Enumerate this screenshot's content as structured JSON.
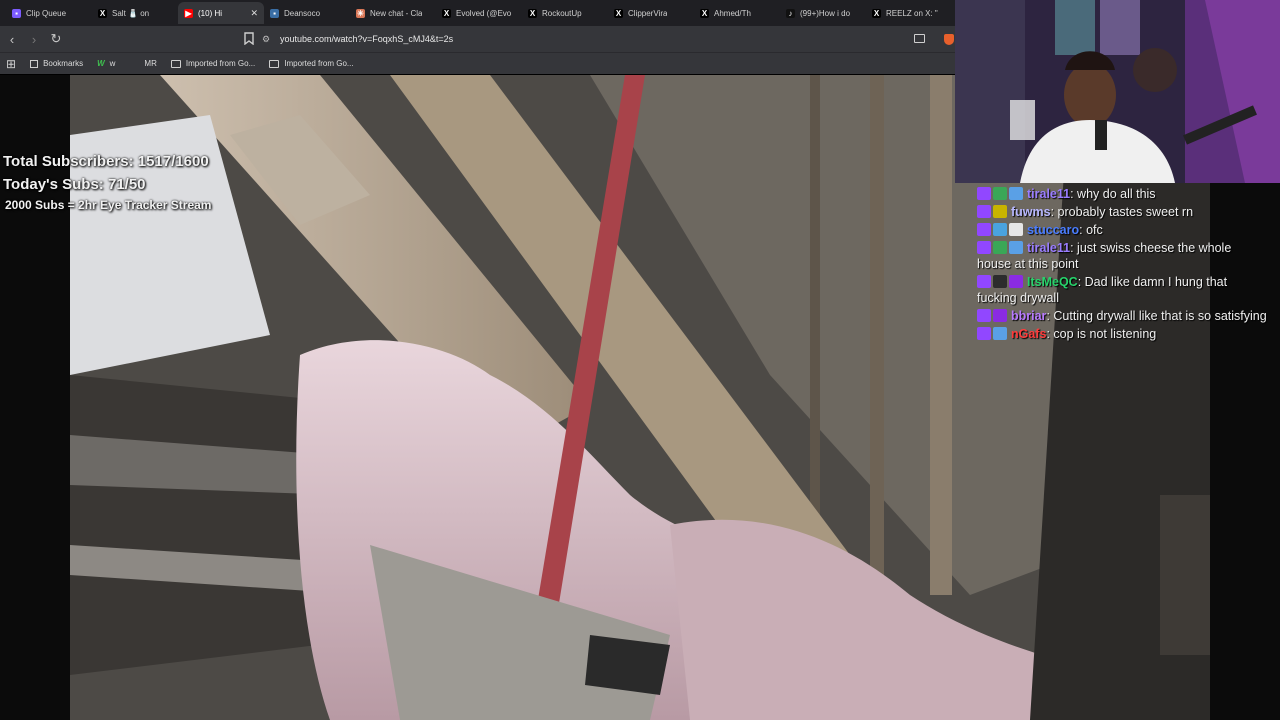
{
  "tabs": [
    {
      "label": "Clip Queue",
      "icon": "clip-queue-icon",
      "color": "#7c5cff",
      "glyph": "▪",
      "active": false
    },
    {
      "label": "Salt 🧂 on",
      "icon": "x-logo-icon",
      "color": "#000000",
      "glyph": "X",
      "active": false
    },
    {
      "label": "(10) Hi",
      "icon": "youtube-icon",
      "color": "#ff0000",
      "glyph": "▶",
      "active": true
    },
    {
      "label": "Deansoco",
      "icon": "generic-site-icon",
      "color": "#3a6ea5",
      "glyph": "▪",
      "active": false
    },
    {
      "label": "New chat - Cla",
      "icon": "claude-icon",
      "color": "#d97757",
      "glyph": "✳",
      "active": false
    },
    {
      "label": "Evolved (@Evo",
      "icon": "x-logo-icon",
      "color": "#000000",
      "glyph": "X",
      "active": false
    },
    {
      "label": "RockoutUp",
      "icon": "x-logo-icon",
      "color": "#000000",
      "glyph": "X",
      "active": false
    },
    {
      "label": "ClipperVira",
      "icon": "x-logo-icon",
      "color": "#000000",
      "glyph": "X",
      "active": false
    },
    {
      "label": "Ahmed/Th",
      "icon": "x-logo-icon",
      "color": "#000000",
      "glyph": "X",
      "active": false
    },
    {
      "label": "(99+)How i do",
      "icon": "tiktok-icon",
      "color": "#111111",
      "glyph": "♪",
      "active": false
    },
    {
      "label": "REELZ on X: \"",
      "icon": "x-logo-icon",
      "color": "#000000",
      "glyph": "X",
      "active": false
    }
  ],
  "close_glyph": "✕",
  "nav": {
    "back": "‹",
    "forward": "›",
    "reload": "↻"
  },
  "url": "youtube.com/watch?v=FoqxhS_cMJ4&t=2s",
  "bookmarks": {
    "apps_glyph": "⊞",
    "items": [
      {
        "label": "Bookmarks",
        "icon": "bookmarks-icon"
      },
      {
        "label": "w",
        "icon": "w-site-icon"
      },
      {
        "label": "MR",
        "icon": "folder-icon"
      },
      {
        "label": "Imported from Go...",
        "icon": "folder-icon"
      },
      {
        "label": "Imported from Go...",
        "icon": "folder-icon"
      }
    ]
  },
  "overlay": {
    "total_subs": "Total Subscribers: 1517/1600",
    "today_subs": "Today's Subs: 71/50",
    "goal": "2000 Subs = 2hr Eye Tracker Stream"
  },
  "chat": [
    {
      "user": "tirale11",
      "color": "#9a7dff",
      "text": "why do all this",
      "badges": [
        "#9147ff",
        "#3aa757",
        "#5aa0e6"
      ]
    },
    {
      "user": "fuwms",
      "color": "#b8b8ff",
      "text": "probably tastes sweet rn",
      "badges": [
        "#9147ff",
        "#c8b400"
      ]
    },
    {
      "user": "stuccaro",
      "color": "#4a7dff",
      "text": "ofc",
      "badges": [
        "#9147ff",
        "#4aa3df",
        "#e6e6e6"
      ]
    },
    {
      "user": "tirale11",
      "color": "#9a7dff",
      "text": "just swiss cheese the whole house at this point",
      "badges": [
        "#9147ff",
        "#3aa757",
        "#5aa0e6"
      ]
    },
    {
      "user": "ItsMeQC",
      "color": "#27d36b",
      "text": "Dad like damn I hung that fucking drywall",
      "badges": [
        "#9147ff",
        "#2c2c2c",
        "#8a2be2"
      ]
    },
    {
      "user": "bbriar",
      "color": "#b87bff",
      "text": "Cutting drywall like that is so satisfying",
      "badges": [
        "#9147ff",
        "#8a2be2"
      ]
    },
    {
      "user": "nGafs",
      "color": "#ff3b3b",
      "text": "cop is not listening",
      "badges": [
        "#9147ff",
        "#5aa0e6"
      ]
    }
  ]
}
